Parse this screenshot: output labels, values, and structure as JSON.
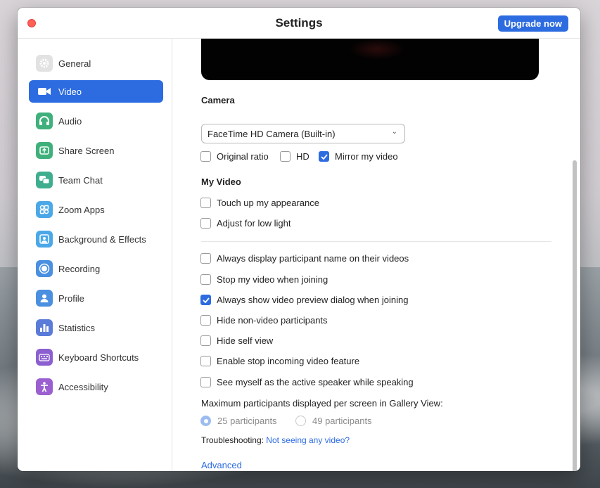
{
  "window": {
    "title": "Settings",
    "upgrade_label": "Upgrade now"
  },
  "sidebar": {
    "items": [
      {
        "label": "General",
        "icon": "gear-icon",
        "color": "#cfcfcf",
        "active": false
      },
      {
        "label": "Video",
        "icon": "video-camera-icon",
        "color": "#ffffff",
        "active": true
      },
      {
        "label": "Audio",
        "icon": "headphones-icon",
        "color": "#3fb07b",
        "active": false
      },
      {
        "label": "Share Screen",
        "icon": "share-screen-icon",
        "color": "#3fb07b",
        "active": false
      },
      {
        "label": "Team Chat",
        "icon": "chat-icon",
        "color": "#3fae8f",
        "active": false
      },
      {
        "label": "Zoom Apps",
        "icon": "apps-icon",
        "color": "#4ba8e8",
        "active": false
      },
      {
        "label": "Background & Effects",
        "icon": "background-icon",
        "color": "#4ba8e8",
        "active": false
      },
      {
        "label": "Recording",
        "icon": "record-icon",
        "color": "#4a8fe0",
        "active": false
      },
      {
        "label": "Profile",
        "icon": "profile-icon",
        "color": "#4a8fe0",
        "active": false
      },
      {
        "label": "Statistics",
        "icon": "statistics-icon",
        "color": "#5a7bd8",
        "active": false
      },
      {
        "label": "Keyboard Shortcuts",
        "icon": "keyboard-icon",
        "color": "#8b5fd0",
        "active": false
      },
      {
        "label": "Accessibility",
        "icon": "accessibility-icon",
        "color": "#9b5fd0",
        "active": false
      }
    ]
  },
  "video": {
    "camera_title": "Camera",
    "camera_select": "FaceTime HD Camera (Built-in)",
    "camera_options": [
      {
        "label": "Original ratio",
        "checked": false
      },
      {
        "label": "HD",
        "checked": false
      },
      {
        "label": "Mirror my video",
        "checked": true
      }
    ],
    "my_video_title": "My Video",
    "my_video_options": [
      {
        "label": "Touch up my appearance",
        "checked": false
      },
      {
        "label": "Adjust for low light",
        "checked": false
      }
    ],
    "general_options": [
      {
        "label": "Always display participant name on their videos",
        "checked": false
      },
      {
        "label": "Stop my video when joining",
        "checked": false
      },
      {
        "label": "Always show video preview dialog when joining",
        "checked": true
      },
      {
        "label": "Hide non-video participants",
        "checked": false
      },
      {
        "label": "Hide self view",
        "checked": false
      },
      {
        "label": "Enable stop incoming video feature",
        "checked": false
      },
      {
        "label": "See myself as the active speaker while speaking",
        "checked": false
      }
    ],
    "gallery_label": "Maximum participants displayed per screen in Gallery View:",
    "gallery_options": [
      {
        "label": "25 participants",
        "selected": true
      },
      {
        "label": "49 participants",
        "selected": false
      }
    ],
    "troubleshooting_label": "Troubleshooting:",
    "troubleshooting_link": "Not seeing any video?",
    "advanced_link": "Advanced"
  }
}
